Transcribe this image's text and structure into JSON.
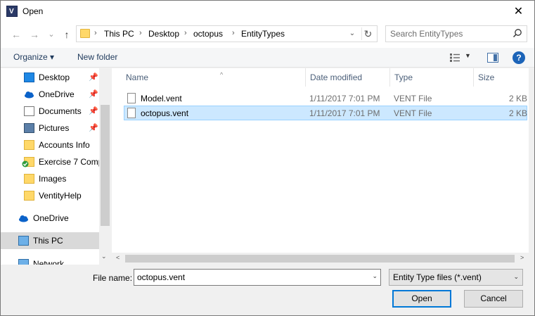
{
  "window": {
    "title": "Open",
    "close_glyph": "✕"
  },
  "nav": {
    "back_glyph": "←",
    "forward_glyph": "→",
    "history_glyph": "⌄",
    "up_glyph": "↑",
    "breadcrumbs": [
      "This PC",
      "Desktop",
      "octopus",
      "EntityTypes"
    ],
    "separator": "›",
    "address_dropdown_glyph": "⌄",
    "refresh_glyph": "↻",
    "search_placeholder": "Search EntityTypes"
  },
  "toolbar": {
    "organize_label": "Organize ▾",
    "new_folder_label": "New folder",
    "view_caret": "▼",
    "help_label": "?"
  },
  "sidebar": {
    "items": [
      {
        "label": "Desktop",
        "icon": "desktop-icon",
        "pinned": true
      },
      {
        "label": "OneDrive",
        "icon": "onedrive-icon",
        "pinned": true
      },
      {
        "label": "Documents",
        "icon": "documents-icon",
        "pinned": true
      },
      {
        "label": "Pictures",
        "icon": "pictures-icon",
        "pinned": true
      },
      {
        "label": "Accounts Info",
        "icon": "folder-icon",
        "pinned": false
      },
      {
        "label": "Exercise 7 Comp",
        "icon": "folder-synced-icon",
        "pinned": false
      },
      {
        "label": "Images",
        "icon": "folder-icon",
        "pinned": false
      },
      {
        "label": "VentityHelp",
        "icon": "folder-icon",
        "pinned": false
      }
    ],
    "onedrive_label": "OneDrive",
    "thispc_label": "This PC",
    "network_label": "Network",
    "pin_glyph": "📌",
    "scroll_down_glyph": "⌄"
  },
  "filelist": {
    "columns": [
      "Name",
      "Date modified",
      "Type",
      "Size"
    ],
    "sort_caret": "^",
    "rows": [
      {
        "name": "Model.vent",
        "date": "1/11/2017 7:01 PM",
        "type": "VENT File",
        "size": "2 KB",
        "selected": false
      },
      {
        "name": "octopus.vent",
        "date": "1/11/2017 7:01 PM",
        "type": "VENT File",
        "size": "2 KB",
        "selected": true
      }
    ],
    "scroll_left_glyph": "<",
    "scroll_right_glyph": ">"
  },
  "footer": {
    "file_name_label": "File name:",
    "file_name_value": "octopus.vent",
    "file_name_caret": "⌄",
    "file_type_value": "Entity Type files (*.vent)",
    "file_type_caret": "⌄",
    "open_label": "Open",
    "cancel_label": "Cancel"
  },
  "colors": {
    "selection_bg": "#cce8ff",
    "selection_border": "#99d1ff",
    "accent": "#0078d7",
    "folder": "#ffd869"
  }
}
